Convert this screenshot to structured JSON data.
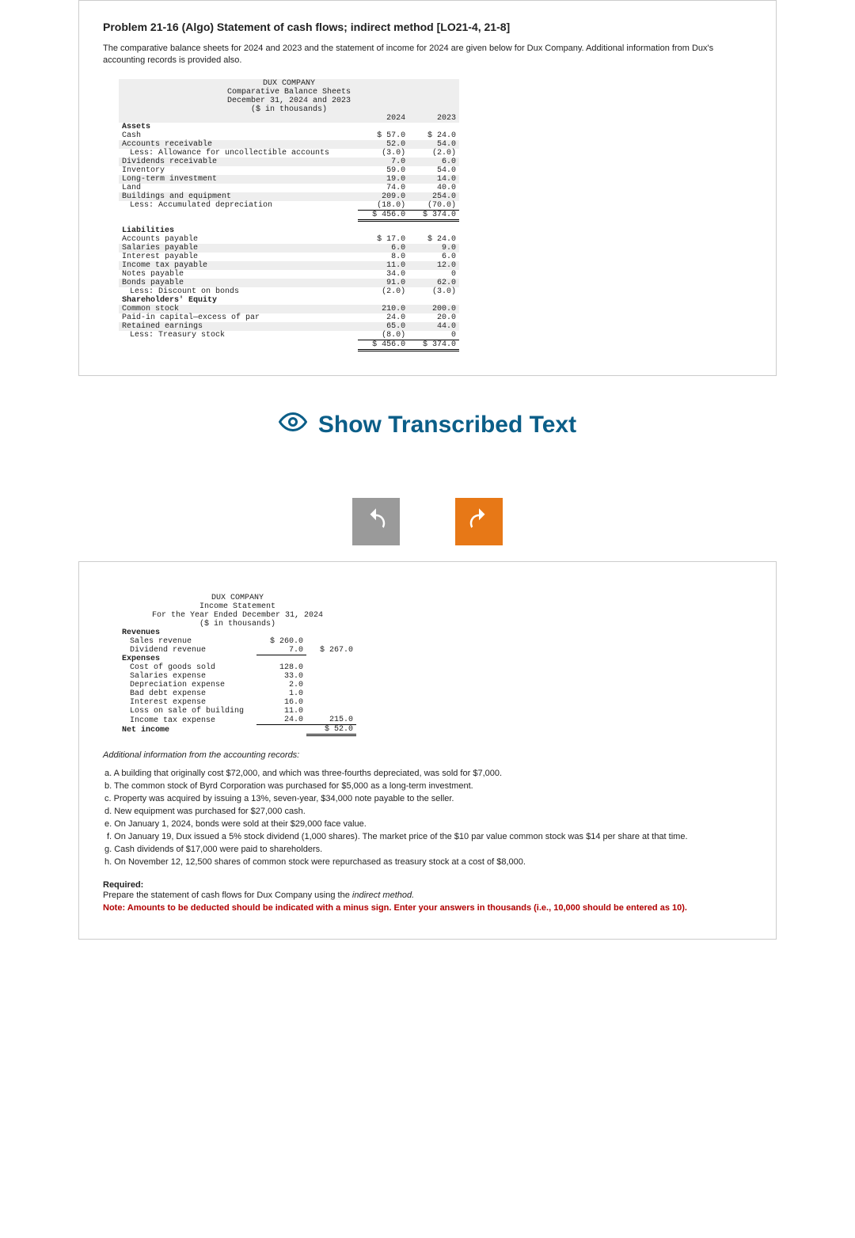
{
  "problem": {
    "title": "Problem 21-16 (Algo) Statement of cash flows; indirect method [LO21-4, 21-8]",
    "description": "The comparative balance sheets for 2024 and 2023 and the statement of income for 2024 are given below for Dux Company. Additional information from Dux's accounting records is provided also."
  },
  "balance_sheet": {
    "heading1": "DUX COMPANY",
    "heading2": "Comparative Balance Sheets",
    "heading3": "December 31, 2024 and 2023",
    "heading4": "($ in thousands)",
    "col_2024": "2024",
    "col_2023": "2023",
    "assets_label": "Assets",
    "rows_assets": [
      {
        "label": "Cash",
        "v24": "$ 57.0",
        "v23": "$ 24.0"
      },
      {
        "label": "Accounts receivable",
        "v24": "52.0",
        "v23": "54.0"
      },
      {
        "label": "Less: Allowance for uncollectible accounts",
        "indent": 1,
        "v24": "(3.0)",
        "v23": "(2.0)"
      },
      {
        "label": "Dividends receivable",
        "v24": "7.0",
        "v23": "6.0"
      },
      {
        "label": "Inventory",
        "v24": "59.0",
        "v23": "54.0"
      },
      {
        "label": "Long-term investment",
        "v24": "19.0",
        "v23": "14.0"
      },
      {
        "label": "Land",
        "v24": "74.0",
        "v23": "40.0"
      },
      {
        "label": "Buildings and equipment",
        "v24": "209.0",
        "v23": "254.0"
      },
      {
        "label": "Less: Accumulated depreciation",
        "indent": 1,
        "v24": "(18.0)",
        "v23": "(70.0)"
      }
    ],
    "assets_total_24": "$ 456.0",
    "assets_total_23": "$ 374.0",
    "liab_label": "Liabilities",
    "rows_liab": [
      {
        "label": "Accounts payable",
        "v24": "$ 17.0",
        "v23": "$ 24.0"
      },
      {
        "label": "Salaries payable",
        "v24": "6.0",
        "v23": "9.0"
      },
      {
        "label": "Interest payable",
        "v24": "8.0",
        "v23": "6.0"
      },
      {
        "label": "Income tax payable",
        "v24": "11.0",
        "v23": "12.0"
      },
      {
        "label": "Notes payable",
        "v24": "34.0",
        "v23": "0"
      },
      {
        "label": "Bonds payable",
        "v24": "91.0",
        "v23": "62.0"
      },
      {
        "label": "Less: Discount on bonds",
        "indent": 1,
        "v24": "(2.0)",
        "v23": "(3.0)"
      }
    ],
    "eq_label": "Shareholders' Equity",
    "rows_eq": [
      {
        "label": "Common stock",
        "v24": "210.0",
        "v23": "200.0"
      },
      {
        "label": "Paid-in capital—excess of par",
        "v24": "24.0",
        "v23": "20.0"
      },
      {
        "label": "Retained earnings",
        "v24": "65.0",
        "v23": "44.0"
      },
      {
        "label": "Less: Treasury stock",
        "indent": 1,
        "v24": "(8.0)",
        "v23": "0"
      }
    ],
    "total_24": "$ 456.0",
    "total_23": "$ 374.0"
  },
  "show_transcribed": "Show Transcribed Text",
  "income_statement": {
    "heading1": "DUX COMPANY",
    "heading2": "Income Statement",
    "heading3": "For the Year Ended December 31, 2024",
    "heading4": "($ in thousands)",
    "rev_label": "Revenues",
    "sales_label": "Sales revenue",
    "sales_val": "$ 260.0",
    "div_label": "Dividend revenue",
    "div_val": "7.0",
    "rev_total": "$ 267.0",
    "exp_label": "Expenses",
    "exp_rows": [
      {
        "label": "Cost of goods sold",
        "v": "128.0"
      },
      {
        "label": "Salaries expense",
        "v": "33.0"
      },
      {
        "label": "Depreciation expense",
        "v": "2.0"
      },
      {
        "label": "Bad debt expense",
        "v": "1.0"
      },
      {
        "label": "Interest expense",
        "v": "16.0"
      },
      {
        "label": "Loss on sale of building",
        "v": "11.0"
      },
      {
        "label": "Income tax expense",
        "v": "24.0"
      }
    ],
    "exp_total": "215.0",
    "net_label": "Net income",
    "net_val": "$ 52.0"
  },
  "additional_info_heading": "Additional information from the accounting records:",
  "notes": [
    "a. A building that originally cost $72,000, and which was three-fourths depreciated, was sold for $7,000.",
    "b. The common stock of Byrd Corporation was purchased for $5,000 as a long-term investment.",
    "c. Property was acquired by issuing a 13%, seven-year, $34,000 note payable to the seller.",
    "d. New equipment was purchased for $27,000 cash.",
    "e. On January 1, 2024, bonds were sold at their $29,000 face value.",
    "f. On January 19, Dux issued a 5% stock dividend (1,000 shares). The market price of the $10 par value common stock was $14 per share at that time.",
    "g. Cash dividends of $17,000 were paid to shareholders.",
    "h. On November 12, 12,500 shares of common stock were repurchased as treasury stock at a cost of $8,000."
  ],
  "required": {
    "heading": "Required:",
    "line1a": "Prepare the statement of cash flows for Dux Company using the ",
    "line1b": "indirect method.",
    "note": "Note: Amounts to be deducted should be indicated with a minus sign. Enter your answers in thousands (i.e., 10,000 should be entered as 10)."
  }
}
